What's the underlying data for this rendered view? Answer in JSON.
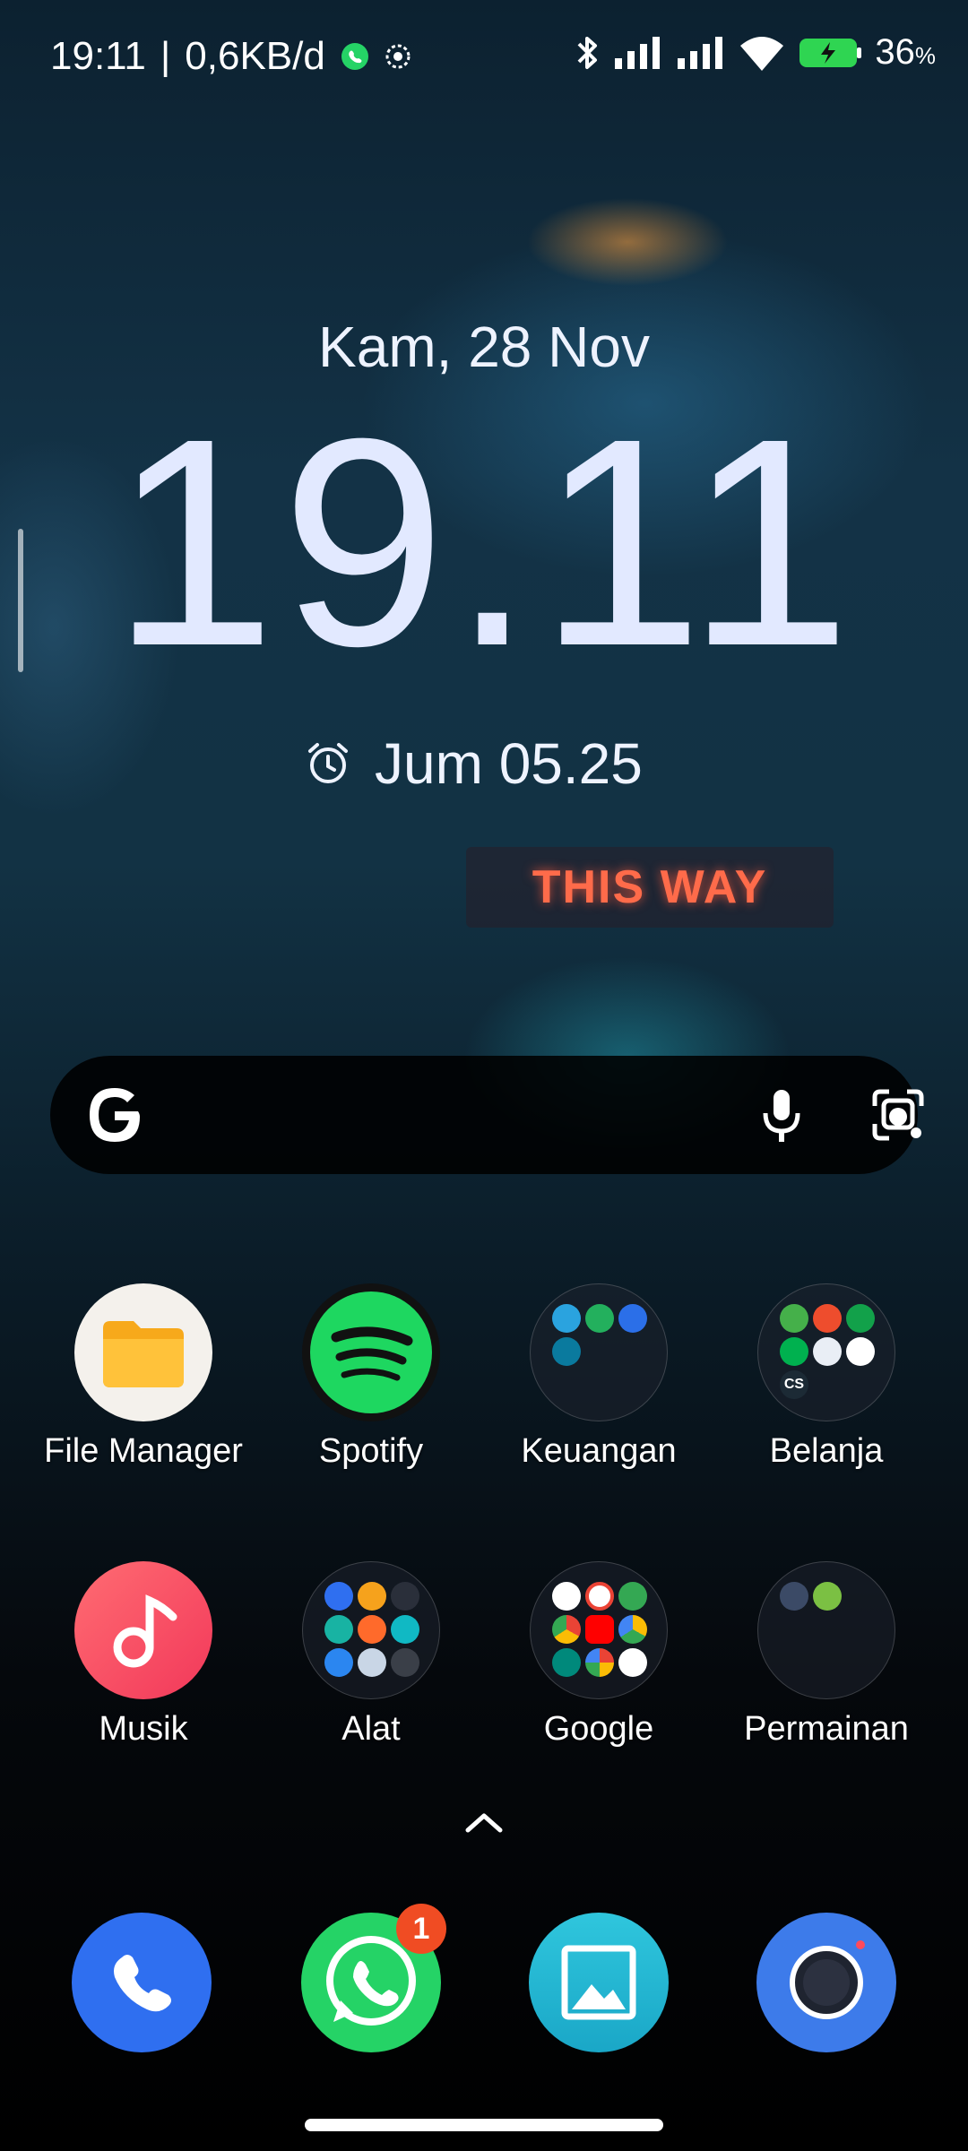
{
  "status_bar": {
    "time": "19:11",
    "separator": "|",
    "network_speed": "0,6KB/d",
    "notification_icons": [
      "whatsapp-icon",
      "settings-gear-icon"
    ],
    "system_icons": [
      "bluetooth-icon",
      "signal-sim1-icon",
      "signal-sim2-icon",
      "wifi-icon",
      "battery-charging-icon"
    ],
    "battery_level": "36",
    "battery_unit": "%"
  },
  "lockwidget": {
    "date": "Kam, 28 Nov",
    "clock": "19.11",
    "alarm_label": "Jum 05.25"
  },
  "wallpaper_sign": "THIS WAY",
  "search": {
    "logo": "google-g-icon",
    "mic": "microphone-icon",
    "lens": "google-lens-icon"
  },
  "apps_row1": [
    {
      "label": "File Manager",
      "icon": "folder-icon"
    },
    {
      "label": "Spotify",
      "icon": "spotify-icon"
    },
    {
      "label": "Keuangan",
      "icon": "folder-keuangan"
    },
    {
      "label": "Belanja",
      "icon": "folder-belanja"
    }
  ],
  "apps_row2": [
    {
      "label": "Musik",
      "icon": "music-note-icon"
    },
    {
      "label": "Alat",
      "icon": "folder-alat"
    },
    {
      "label": "Google",
      "icon": "folder-google"
    },
    {
      "label": "Permainan",
      "icon": "folder-permainan"
    }
  ],
  "belanja_mini_text": "CS",
  "dock": [
    {
      "name": "phone",
      "icon": "phone-icon"
    },
    {
      "name": "whatsapp",
      "icon": "whatsapp-icon",
      "badge": "1"
    },
    {
      "name": "gallery",
      "icon": "gallery-icon"
    },
    {
      "name": "camera",
      "icon": "camera-icon"
    }
  ],
  "colors": {
    "accent_clock": "#e2e9ff",
    "spotify_green": "#1ed760",
    "whatsapp_green": "#25d366",
    "badge_red": "#f04c23",
    "phone_blue": "#2f6ff0"
  }
}
